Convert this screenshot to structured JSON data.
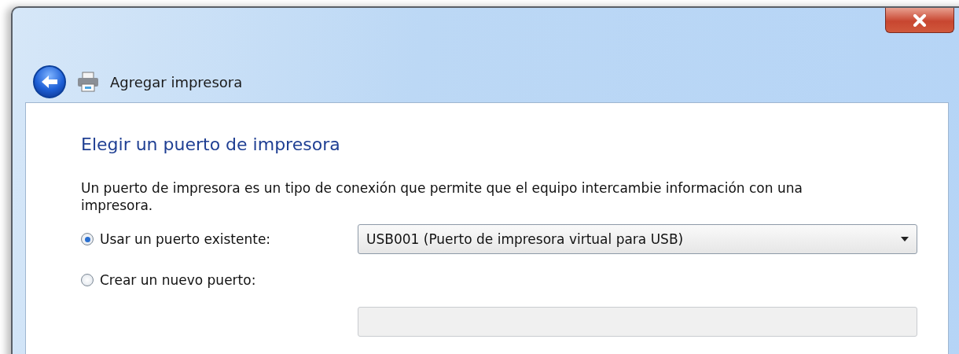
{
  "window": {
    "title": "Agregar impresora"
  },
  "heading": "Elegir un puerto de impresora",
  "description": "Un puerto de impresora es un tipo de conexión que permite que el equipo intercambie información con una impresora.",
  "options": [
    {
      "label": "Usar un puerto existente:",
      "selected": true,
      "field": {
        "value": "USB001 (Puerto de impresora virtual para USB)",
        "disabled": false
      }
    },
    {
      "label": "Crear un nuevo puerto:",
      "selected": false,
      "field": {
        "disabled": true
      }
    }
  ]
}
